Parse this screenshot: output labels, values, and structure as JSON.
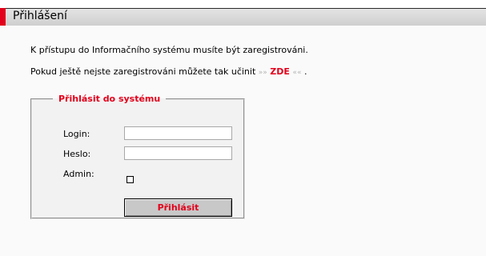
{
  "header": {
    "title": "Přihlášení"
  },
  "intro": {
    "line1": "K přístupu do Informačního systému musíte být zaregistrováni.",
    "line2_prefix": "Pokud ještě nejste zaregistrováni můžete tak učinit",
    "arrow_left": "»",
    "link_text": "ZDE",
    "arrow_right": "«",
    "line2_suffix": "."
  },
  "login_form": {
    "legend": "Přihlásit do systému",
    "login_label": "Login:",
    "login_value": "",
    "password_label": "Heslo:",
    "password_value": "",
    "admin_label": "Admin:",
    "admin_checked": false,
    "submit_label": "Přihlásit"
  },
  "colors": {
    "accent": "#e3001b",
    "header_bg": "#d8d8d8",
    "panel_bg": "#f2f2f2"
  }
}
